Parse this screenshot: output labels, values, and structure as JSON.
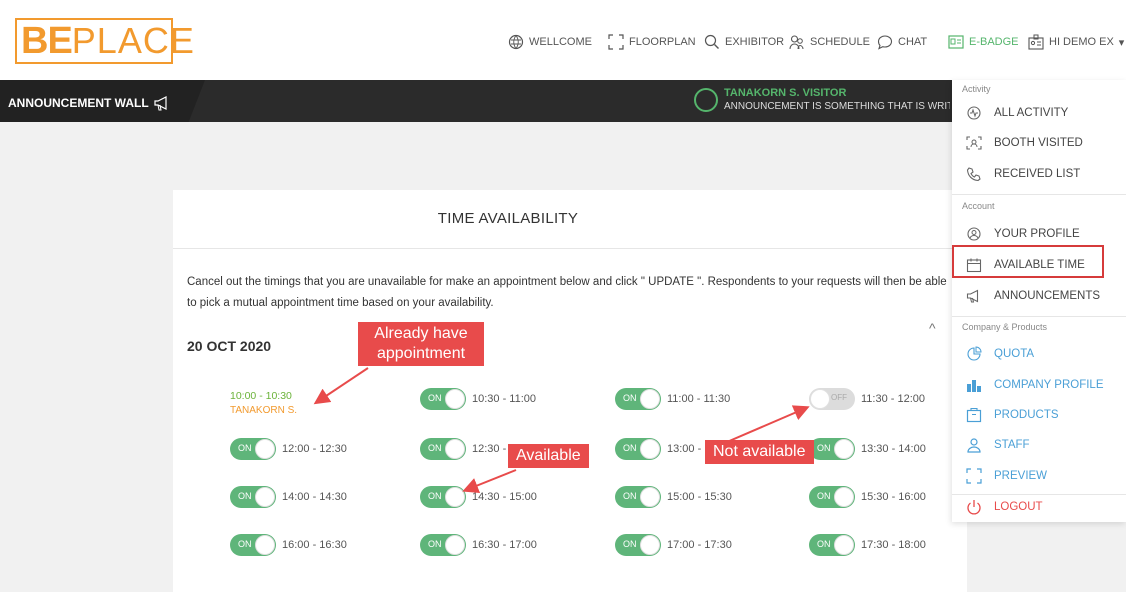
{
  "header": {
    "logo_be": "BE",
    "logo_place": "PLACE",
    "nav": [
      {
        "label": "WELLCOME",
        "icon": "globe-icon"
      },
      {
        "label": "FLOORPLAN",
        "icon": "floorplan-icon"
      },
      {
        "label": "EXHIBITOR",
        "icon": "search-icon"
      },
      {
        "label": "SCHEDULE",
        "icon": "people-icon"
      },
      {
        "label": "CHAT",
        "icon": "chat-icon"
      },
      {
        "label": "E-BADGE",
        "icon": "badge-icon"
      },
      {
        "label": "HI DEMO EX",
        "icon": "user-card-icon"
      }
    ],
    "user_caret": "▾"
  },
  "announcement": {
    "title": "ANNOUNCEMENT WALL",
    "sender": "TANAKORN S. VISITOR",
    "message": "ANNOUNCEMENT IS SOMETHING THAT IS WRITTEN. LIM"
  },
  "card": {
    "title": "TIME AVAILABILITY",
    "description": "Cancel out the timings that you are unavailable for make an appointment below and click \" UPDATE \". Respondents to your requests will then be able to pick a mutual appointment time based on your availability.",
    "date": "20 OCT 2020",
    "collapse_icon": "^",
    "booked": {
      "time": "10:00 - 10:30",
      "name": "TANAKORN S."
    },
    "on_label": "ON",
    "off_label": "OFF",
    "slots": [
      {
        "time": "10:30 - 11:00",
        "on": true
      },
      {
        "time": "11:00 - 11:30",
        "on": true
      },
      {
        "time": "11:30 - 12:00",
        "on": false
      },
      {
        "time": "12:00 - 12:30",
        "on": true
      },
      {
        "time": "12:30 - 13:00",
        "on": true
      },
      {
        "time": "13:00 - 13:30",
        "on": true
      },
      {
        "time": "13:30 - 14:00",
        "on": true
      },
      {
        "time": "14:00 - 14:30",
        "on": true
      },
      {
        "time": "14:30 - 15:00",
        "on": true
      },
      {
        "time": "15:00 - 15:30",
        "on": true
      },
      {
        "time": "15:30 - 16:00",
        "on": true
      },
      {
        "time": "16:00 - 16:30",
        "on": true
      },
      {
        "time": "16:30 - 17:00",
        "on": true
      },
      {
        "time": "17:00 - 17:30",
        "on": true
      },
      {
        "time": "17:30 - 18:00",
        "on": true
      }
    ]
  },
  "callouts": {
    "already_line1": "Already have",
    "already_line2": "appointment",
    "available": "Available",
    "not_available": "Not available"
  },
  "dropdown": {
    "section_activity": "Activity",
    "section_account": "Account",
    "section_company": "Company & Products",
    "activity": [
      {
        "label": "ALL ACTIVITY",
        "icon": "activity-icon"
      },
      {
        "label": "BOOTH VISITED",
        "icon": "booth-icon"
      },
      {
        "label": "RECEIVED LIST",
        "icon": "phone-icon"
      }
    ],
    "account": [
      {
        "label": "YOUR PROFILE",
        "icon": "profile-icon"
      },
      {
        "label": "AVAILABLE TIME",
        "icon": "calendar-icon"
      },
      {
        "label": "ANNOUNCEMENTS",
        "icon": "megaphone-icon"
      }
    ],
    "company": [
      {
        "label": "QUOTA",
        "icon": "quota-icon"
      },
      {
        "label": "COMPANY PROFILE",
        "icon": "company-icon"
      },
      {
        "label": "PRODUCTS",
        "icon": "products-icon"
      },
      {
        "label": "STAFF",
        "icon": "staff-icon"
      },
      {
        "label": "PREVIEW",
        "icon": "preview-icon"
      }
    ],
    "logout": "LOGOUT"
  },
  "colors": {
    "accent_orange": "#f29a2e",
    "toggle_green": "#5fb57a",
    "callout_red": "#e84b4b",
    "link_blue": "#4a9fd6"
  }
}
